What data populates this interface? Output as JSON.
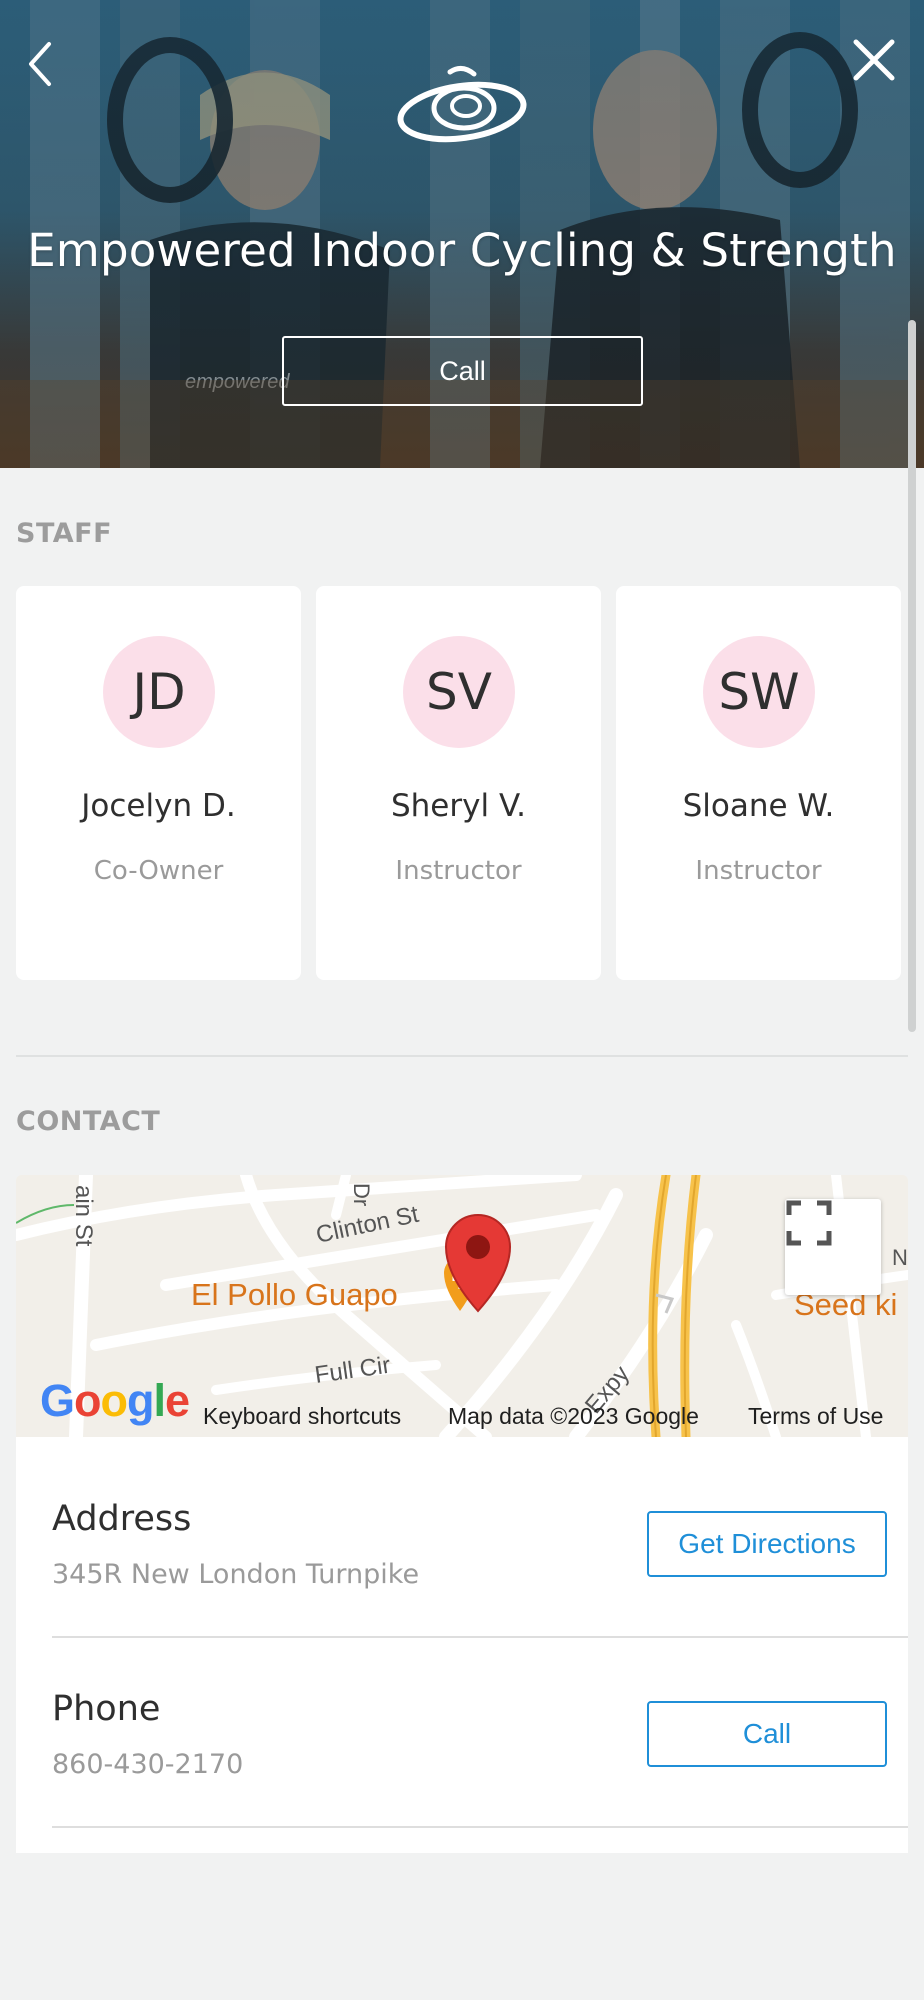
{
  "hero": {
    "title": "Empowered Indoor Cycling & Strength",
    "call_label": "Call",
    "photo_print": "empowered"
  },
  "staff": {
    "section_label": "STAFF",
    "members": [
      {
        "initials": "JD",
        "name": "Jocelyn D.",
        "role": "Co-Owner"
      },
      {
        "initials": "SV",
        "name": "Sheryl V.",
        "role": "Instructor"
      },
      {
        "initials": "SW",
        "name": "Sloane W.",
        "role": "Instructor"
      }
    ]
  },
  "contact": {
    "section_label": "CONTACT",
    "map": {
      "streets": [
        "ain St",
        "Dr",
        "Clinton St",
        "Full Cir",
        "Expy",
        "N"
      ],
      "places": [
        "El Pollo Guapo",
        "Seed ki"
      ],
      "google_logo": "Google",
      "keyboard_shortcuts": "Keyboard shortcuts",
      "map_data": "Map data ©2023 Google",
      "terms": "Terms of Use"
    },
    "address": {
      "title": "Address",
      "value": "345R New London Turnpike",
      "button_label": "Get Directions"
    },
    "phone": {
      "title": "Phone",
      "value": "860-430-2170",
      "button_label": "Call"
    }
  },
  "colors": {
    "accent": "#1f8fd8",
    "avatar_bg": "#fbdfe9",
    "page_bg": "#f1f2f2",
    "map_place": "#d8741b",
    "pin": "#e53935"
  },
  "icons": {
    "back": "chevron-left-icon",
    "close": "close-icon",
    "logo": "spiral-logo-icon",
    "fullscreen": "fullscreen-icon",
    "pin": "map-pin-icon",
    "restaurant": "restaurant-icon"
  }
}
